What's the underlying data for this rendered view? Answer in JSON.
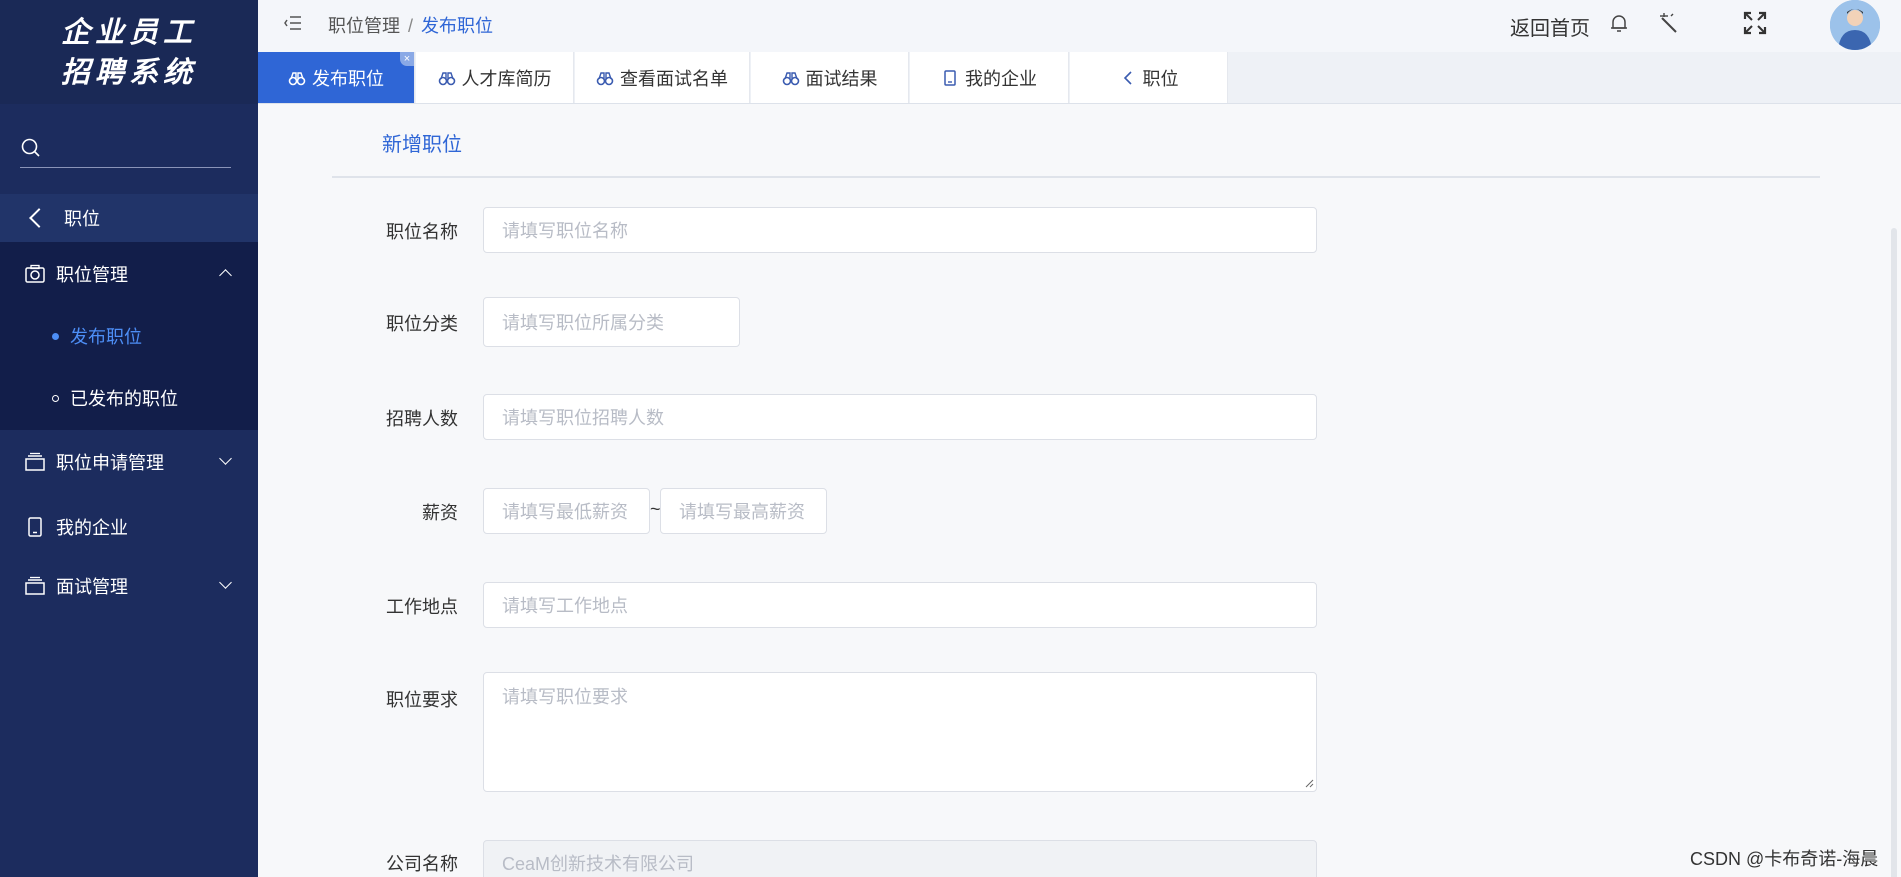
{
  "app": {
    "logo_line1": "企业员工",
    "logo_line2": "招聘系统"
  },
  "sidebar": {
    "search_placeholder": "",
    "back_label": "职位",
    "menu": [
      {
        "label": "职位管理",
        "expanded": true
      },
      {
        "label": "职位申请管理",
        "expanded": false
      },
      {
        "label": "我的企业"
      },
      {
        "label": "面试管理",
        "expanded": false
      }
    ],
    "sub_items": [
      {
        "label": "发布职位",
        "active": true
      },
      {
        "label": "已发布的职位",
        "active": false
      }
    ]
  },
  "header": {
    "breadcrumb": [
      "职位管理",
      "发布职位"
    ],
    "separator": "/",
    "back_home": "返回首页"
  },
  "tabs": [
    {
      "label": "发布职位",
      "active": true,
      "icon": "binoculars-icon",
      "close": "×"
    },
    {
      "label": "人才库简历",
      "icon": "binoculars-icon"
    },
    {
      "label": "查看面试名单",
      "icon": "binoculars-icon"
    },
    {
      "label": "面试结果",
      "icon": "binoculars-icon"
    },
    {
      "label": "我的企业",
      "icon": "clipboard-icon"
    },
    {
      "label": "职位",
      "icon": "chevron-left-icon"
    }
  ],
  "form": {
    "title": "新增职位",
    "fields": {
      "name": {
        "label": "职位名称",
        "placeholder": "请填写职位名称"
      },
      "category": {
        "label": "职位分类",
        "placeholder": "请填写职位所属分类"
      },
      "count": {
        "label": "招聘人数",
        "placeholder": "请填写职位招聘人数"
      },
      "salary": {
        "label": "薪资",
        "min_placeholder": "请填写最低薪资",
        "max_placeholder": "请填写最高薪资",
        "separator": "~"
      },
      "location": {
        "label": "工作地点",
        "placeholder": "请填写工作地点"
      },
      "requirement": {
        "label": "职位要求",
        "placeholder": "请填写职位要求"
      },
      "company": {
        "label": "公司名称",
        "value": "CeaM创新技术有限公司"
      }
    }
  },
  "watermark": "CSDN @卡布奇诺-海晨",
  "colors": {
    "sidebar_bg": "#1c2c5e",
    "accent": "#2f66d6",
    "active_sub": "#4d8ef6"
  }
}
